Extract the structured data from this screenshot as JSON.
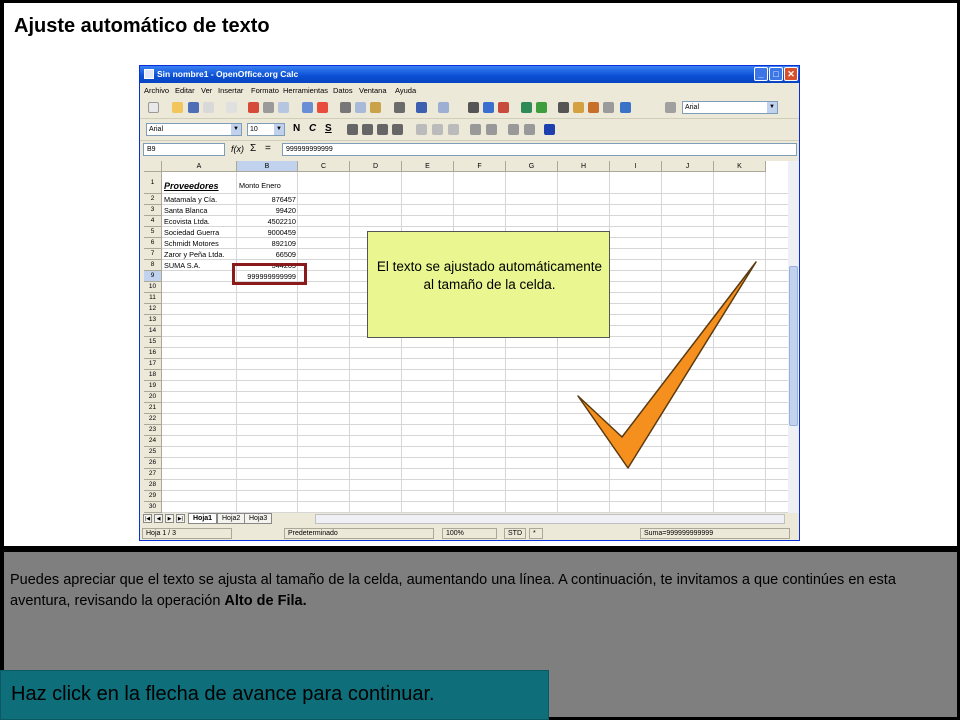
{
  "slide": {
    "title": "Ajuste automático de texto",
    "description_part1": "Puedes apreciar que el texto se ajusta al tamaño de la celda, aumentando una línea. A continuación, te invitamos a que continúes en esta aventura, revisando la operación ",
    "description_bold": "Alto de Fila.",
    "nav_hint": "Haz click en la flecha de avance para continuar.",
    "callout_text": "El texto se ajustado automáticamente al tamaño de la celda."
  },
  "window": {
    "title": "Sin nombre1 - OpenOffice.org Calc",
    "buttons": [
      "_",
      "□",
      "✕"
    ]
  },
  "menu": [
    "Archivo",
    "Editar",
    "Ver",
    "Insertar",
    "Formato",
    "Herramientas",
    "Datos",
    "Ventana",
    "Ayuda"
  ],
  "toolbar": {
    "font_combo_right": "Arial",
    "font_name": "Arial",
    "font_size": "10",
    "format_letters": [
      "N",
      "C",
      "S"
    ]
  },
  "formula_bar": {
    "cell_ref": "B9",
    "fx": "f(x)",
    "sigma": "Σ",
    "equals": "=",
    "value": "999999999999"
  },
  "sheet": {
    "columns": [
      "A",
      "B",
      "C",
      "D",
      "E",
      "F",
      "G",
      "H",
      "I",
      "J",
      "K"
    ],
    "rows": [
      "1",
      "2",
      "3",
      "4",
      "5",
      "6",
      "7",
      "8",
      "9",
      "10",
      "11",
      "12",
      "13",
      "14",
      "15",
      "16",
      "17",
      "18",
      "19",
      "20",
      "21",
      "22",
      "23",
      "24",
      "25",
      "26",
      "27",
      "28",
      "29",
      "30"
    ],
    "header_a": "Proveedores",
    "header_b": "Monto Enero",
    "data": [
      [
        "Matamala y Cía.",
        "876457"
      ],
      [
        "Santa Blanca",
        "99420"
      ],
      [
        "Ecovista Ltda.",
        "4502210"
      ],
      [
        "Sociedad Guerra",
        "9000459"
      ],
      [
        "Schmidt Motores",
        "892109"
      ],
      [
        "Zaror y Peña Ltda.",
        "66509"
      ],
      [
        "SUMA S.A.",
        "344265"
      ]
    ],
    "b9": "999999999999"
  },
  "tabs": [
    "Hoja1",
    "Hoja2",
    "Hoja3"
  ],
  "status": {
    "sheet": "Hoja 1 / 3",
    "style": "Predeterminado",
    "zoom": "100%",
    "mode": "STD",
    "modified": "*",
    "sum": "Suma=999999999999"
  },
  "colors": {
    "callout_bg": "#eaf68f",
    "checkmark": "#f5901e",
    "selection_border": "#8b1a1a",
    "nav_bg": "#0e6e7a"
  }
}
